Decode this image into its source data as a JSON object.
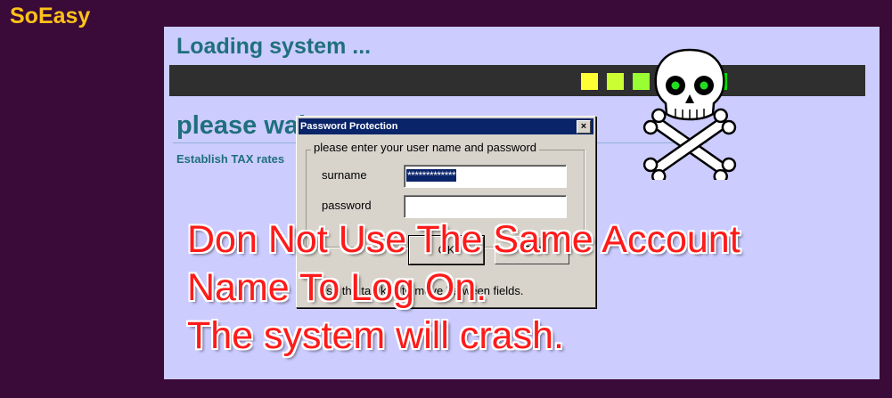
{
  "app": {
    "brand": "SoEasy"
  },
  "loading": {
    "title": "Loading system ...",
    "wait_title": "please wait",
    "status": "Establish TAX rates",
    "progress_block_colors": [
      "#ffff33",
      "#ccff33",
      "#99ff33",
      "#66ff33",
      "#33ee33",
      "#00dd00"
    ]
  },
  "dialog": {
    "title": "Password Protection",
    "close_glyph": "×",
    "group_label": "please enter your user name and password",
    "surname_label": "surname",
    "surname_value": "*************",
    "password_label": "password",
    "password_value": "",
    "ok_label": "OK",
    "exit_label": "Exit",
    "hint": "Use the tab key to move between fields."
  },
  "overlay": {
    "warning_lines": [
      "Don Not Use The Same Account",
      "Name To Log On.",
      "The system will crash."
    ],
    "warning_color": "#ff1a1a"
  },
  "icons": {
    "skull": "skull-crossbones-icon"
  }
}
